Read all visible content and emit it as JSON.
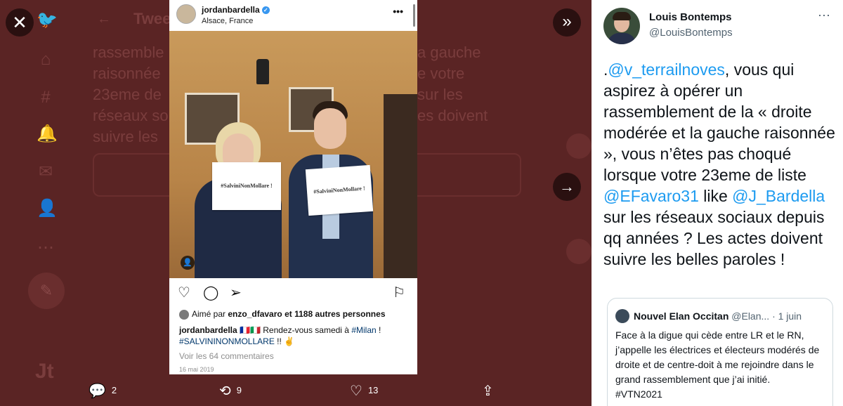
{
  "background": {
    "header_title": "Twee",
    "text_lines": [
      "rassemble",
      "raisonnée",
      "23eme de",
      "réseaux so",
      "suivre les"
    ],
    "text_lines_right": [
      "a gauche",
      "e votre",
      "sur les",
      "es doivent"
    ]
  },
  "controls": {
    "close_label": "✕",
    "expand_label": "»",
    "next_label": "→"
  },
  "instagram": {
    "username": "jordanbardella",
    "location": "Alsace, France",
    "more_label": "•••",
    "sign_text": "#SalviniNonMollare !",
    "likes_prefix": "Aimé par",
    "likes_user": "enzo_dfavaro",
    "likes_suffix": "et 1188 autres personnes",
    "caption_user": "jordanbardella",
    "caption_text": "🇫🇷🇮🇹 Rendez-vous samedi à",
    "caption_tag1": "#Milan",
    "caption_mid": "!",
    "caption_tag2": "#SALVININONMOLLARE",
    "caption_end": "!! ✌️",
    "comments_label": "Voir les 64 commentaires",
    "date": "16 mai 2019"
  },
  "bottom_actions": {
    "replies": "2",
    "retweets": "9",
    "likes": "13"
  },
  "tweet": {
    "author_name": "Louis Bontemps",
    "author_handle": "@LouisBontemps",
    "text_start": ".",
    "mention1": "@v_terrailnoves",
    "text_part1": ", vous qui aspirez à opérer un rassemblement de la « droite modérée et la gauche raisonnée », vous n’êtes pas choqué lorsque votre 23eme de liste",
    "mention2": "@EFavaro31",
    "text_part2": "like",
    "mention3": "@J_Bardella",
    "text_part3": "sur les réseaux sociaux depuis qq années ? Les actes doivent suivre les belles paroles !",
    "quote": {
      "name": "Nouvel Elan Occitan",
      "handle": "@Elan...",
      "date": "· 1 juin",
      "text": "Face à la digue qui cède entre LR et le RN, j’appelle les électrices et électeurs modérés de droite et de centre-doit à me rejoindre dans le grand rassemblement que j’ai initié.",
      "text_tail": "#VTN2021"
    }
  }
}
